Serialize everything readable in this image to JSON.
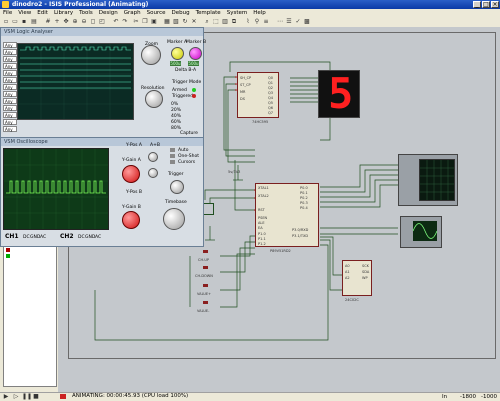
{
  "window": {
    "title": "dinodro2 - ISIS Professional (Animating)"
  },
  "menu": [
    "File",
    "View",
    "Edit",
    "Library",
    "Tools",
    "Design",
    "Graph",
    "Source",
    "Debug",
    "Template",
    "System",
    "Help"
  ],
  "toolbar_icons": [
    "new-icon",
    "open-icon",
    "save-icon",
    "print-icon",
    "grid-icon",
    "origin-icon",
    "pan-icon",
    "zoom-in-icon",
    "zoom-out-icon",
    "zoom-all-icon",
    "zoom-area-icon",
    "undo-icon",
    "redo-icon",
    "cut-icon",
    "copy-icon",
    "paste-icon",
    "block-copy-icon",
    "block-move-icon",
    "block-rotate-icon",
    "block-delete-icon",
    "pick-icon",
    "make-device-icon",
    "package-icon",
    "decompose-icon",
    "wire-autorouter-icon",
    "search-icon",
    "property-icon",
    "netlist-icon",
    "bom-icon",
    "erc-icon",
    "pcb-icon"
  ],
  "logic_analyser": {
    "title": "VSM Logic Analyser",
    "channel_values": [
      "Any",
      "Any",
      "Any",
      "Any",
      "Any",
      "Any",
      "Any",
      "Any",
      "Any",
      "Any",
      "Any",
      "Any",
      "Any",
      "Any"
    ],
    "zoom_label": "Zoom",
    "marker_a": "Marker A",
    "marker_b": "Marker B",
    "delta_label": "Delta B-A",
    "marker_a_value": "500u",
    "marker_b_value": "500u",
    "resolution_label": "Resolution",
    "trigger_mode": "Trigger Mode",
    "armed": "Armed",
    "triggered": "Triggered",
    "capture_label": "Capture",
    "position_labels": [
      "0%",
      "20%",
      "40%",
      "60%",
      "80%"
    ]
  },
  "oscilloscope": {
    "title": "VSM Oscilloscope",
    "y_pos_a": "Y-Pos A",
    "y_gain_a": "Y-Gain A",
    "y_pos_b": "Y-Pos B",
    "y_gain_b": "Y-Gain B",
    "trigger": "Trigger",
    "timebase": "Timebase",
    "couple": [
      "DC",
      "GND",
      "AC"
    ],
    "ch1": "CH1",
    "ch2": "CH2",
    "mode_labels": [
      "A+B",
      "Auto",
      "One-Shot",
      "Cursors"
    ]
  },
  "schematic": {
    "shift_register": {
      "pins_left": [
        "SH_CP",
        "ST_CP",
        "MR",
        "DS"
      ],
      "pins_right": [
        "Q0",
        "Q1",
        "Q2",
        "Q3",
        "Q4",
        "Q5",
        "Q6",
        "Q7",
        "Q7'"
      ],
      "ref": "74HC595"
    },
    "seven_seg": {
      "digit": "5"
    },
    "mcu": {
      "ref": "P89V51RD2",
      "pins_left": [
        "XTAL1",
        "XTAL2",
        "RST",
        "PSEN",
        "ALE",
        "EA",
        "P1.0",
        "P1.1",
        "P1.2",
        "P1.3",
        "P1.4"
      ],
      "pins_right": [
        "P0.0",
        "P0.1",
        "P0.2",
        "P0.3",
        "P0.4",
        "P0.5",
        "P0.6",
        "P0.7",
        "P2.0",
        "P2.1",
        "P3.0/RXD",
        "P3.1/TXD"
      ]
    },
    "eeprom": {
      "ref": "24C02C",
      "pins": [
        "A0",
        "A1",
        "A2",
        "SCK",
        "SDA",
        "WP"
      ]
    },
    "supply_label": "5v/3V3",
    "buttons": [
      "CH-UP",
      "CH-DOWN",
      "VALUE+",
      "VALUE-"
    ]
  },
  "status": {
    "text": "ANIMATING: 00:00:45.93 (CPU load 100%)",
    "coord_x": "-1800",
    "coord_y": "-1000",
    "zoom": "In"
  }
}
